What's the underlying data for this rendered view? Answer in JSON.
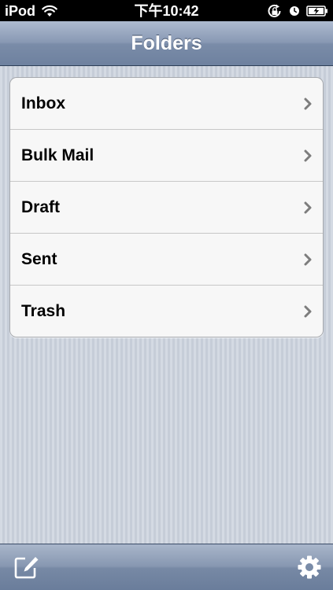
{
  "status_bar": {
    "carrier": "iPod",
    "time": "下午10:42",
    "icons": [
      "wifi-icon",
      "rotation-lock-icon",
      "alarm-clock-icon",
      "battery-charging-icon"
    ]
  },
  "nav_bar": {
    "title": "Folders"
  },
  "folders": [
    {
      "label": "Inbox"
    },
    {
      "label": "Bulk Mail"
    },
    {
      "label": "Draft"
    },
    {
      "label": "Sent"
    },
    {
      "label": "Trash"
    }
  ],
  "toolbar": {
    "left_icon": "compose-icon",
    "right_icon": "gear-icon"
  },
  "colors": {
    "nav_bar": "#8898b3",
    "background": "#cbd2dd",
    "chevron": "#808080"
  }
}
